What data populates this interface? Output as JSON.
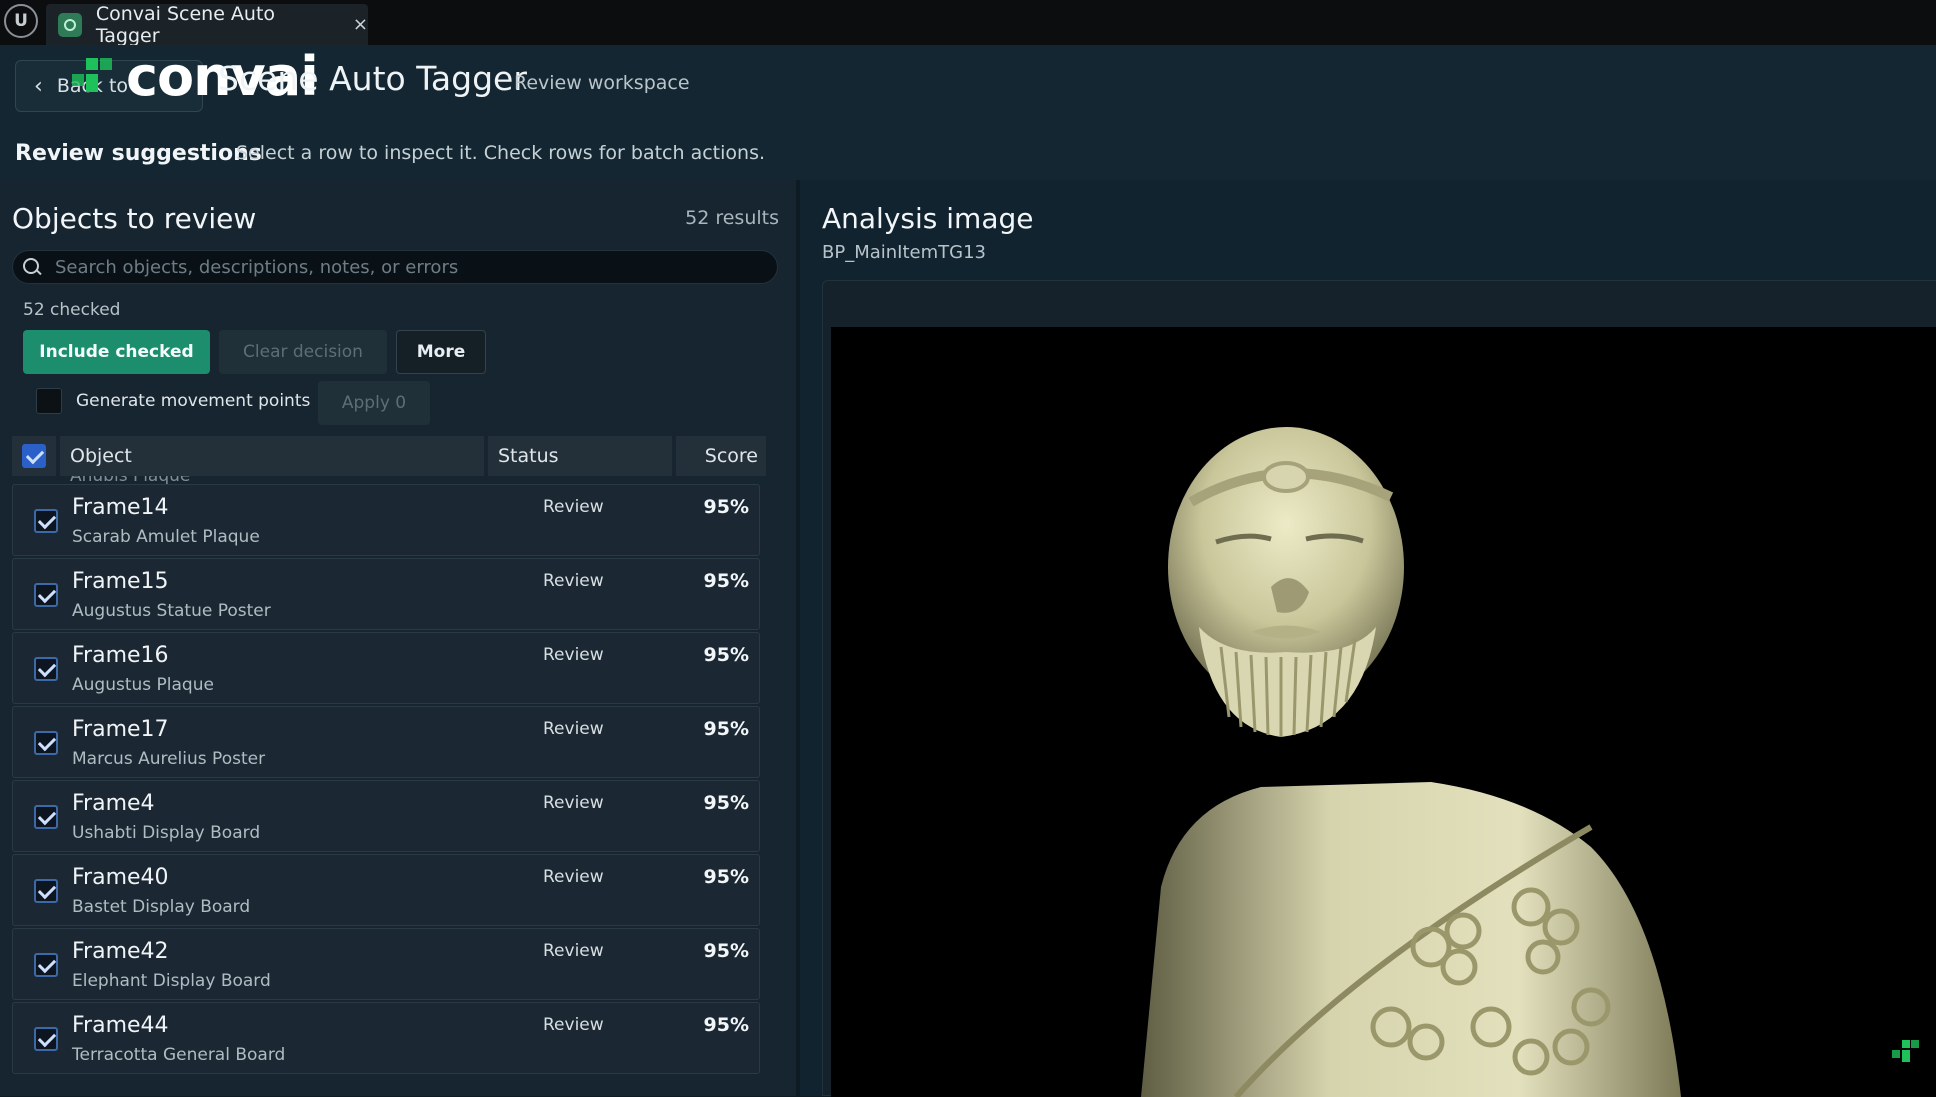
{
  "tab": {
    "title": "Convai Scene Auto Tagger",
    "close": "×"
  },
  "engine_logo": {
    "glyph": "U",
    "icon": "unreal-logo-icon"
  },
  "header": {
    "back_label": "Back to ...",
    "brand_word": "convai",
    "app_title": "Scene Auto Tagger",
    "app_subtitle": "Review workspace",
    "review_title": "Review suggestions",
    "review_hint": "Select a row to inspect it. Check rows for batch actions."
  },
  "left": {
    "title": "Objects to review",
    "result_count": "52 results",
    "search_placeholder": "Search objects, descriptions, notes, or errors",
    "checked_count": "52 checked",
    "include_label": "Include checked",
    "clear_label": "Clear decision",
    "more_label": "More",
    "generate_label": "Generate movement points",
    "apply_label": "Apply 0",
    "columns": {
      "object": "Object",
      "status": "Status",
      "score": "Score"
    },
    "peek_row": "Anubis Plaque",
    "rows": [
      {
        "name": "Frame14",
        "desc": "Scarab Amulet Plaque",
        "status": "Review",
        "score": "95%"
      },
      {
        "name": "Frame15",
        "desc": "Augustus Statue Poster",
        "status": "Review",
        "score": "95%"
      },
      {
        "name": "Frame16",
        "desc": "Augustus Plaque",
        "status": "Review",
        "score": "95%"
      },
      {
        "name": "Frame17",
        "desc": "Marcus Aurelius Poster",
        "status": "Review",
        "score": "95%"
      },
      {
        "name": "Frame4",
        "desc": "Ushabti Display Board",
        "status": "Review",
        "score": "95%"
      },
      {
        "name": "Frame40",
        "desc": "Bastet Display Board",
        "status": "Review",
        "score": "95%"
      },
      {
        "name": "Frame42",
        "desc": "Elephant Display Board",
        "status": "Review",
        "score": "95%"
      },
      {
        "name": "Frame44",
        "desc": "Terracotta General Board",
        "status": "Review",
        "score": "95%"
      }
    ]
  },
  "right": {
    "title": "Analysis image",
    "subtitle": "BP_MainItemTG13"
  },
  "colors": {
    "accent": "#1c8e6e",
    "brand": "#1fc15b",
    "checkbox": "#2a60c7"
  }
}
